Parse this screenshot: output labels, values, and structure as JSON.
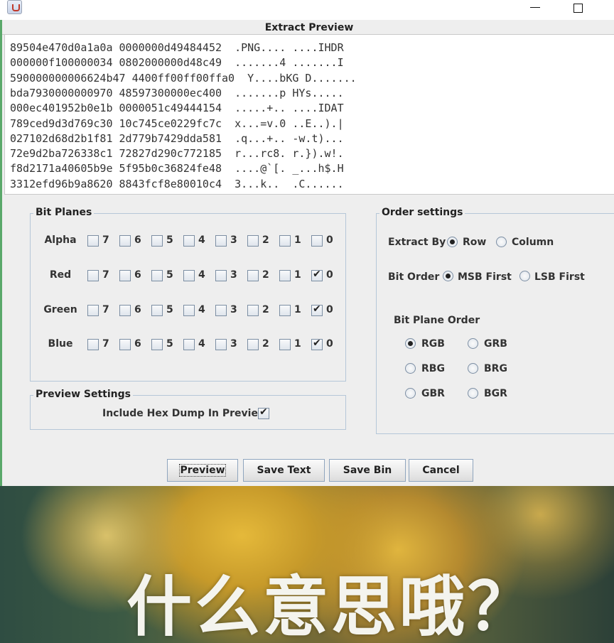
{
  "window": {
    "app_icon": "java-cup-icon"
  },
  "preview": {
    "title": "Extract Preview",
    "lines": [
      "89504e470d0a1a0a 0000000d49484452  .PNG.... ....IHDR",
      "000000f100000034 0802000000d48c49  .......4 .......I",
      "590000000006624b47 4400ff00ff00ffa0  Y....bKG D.......",
      "bda7930000000970 48597300000ec400  .......p HYs.....",
      "000ec401952b0e1b 0000051c49444154  .....+.. ....IDAT",
      "789ced9d3d769c30 10c745ce0229fc7c  x...=v.0 ..E..).|",
      "027102d68d2b1f81 2d779b7429dda581  .q...+.. -w.t)...",
      "72e9d2ba726338c1 72827d290c772185  r...rc8. r.}).w!.",
      "f8d2171a40605b9e 5f95b0c36824fe48  ....@`[. _...h$.H",
      "3312efd96b9a8620 8843fcf8e80010c4  3...k..  .C......"
    ]
  },
  "bit_planes": {
    "title": "Bit Planes",
    "bit_labels": [
      "7",
      "6",
      "5",
      "4",
      "3",
      "2",
      "1",
      "0"
    ],
    "rows": [
      {
        "label": "Alpha",
        "checked": [
          false,
          false,
          false,
          false,
          false,
          false,
          false,
          false
        ]
      },
      {
        "label": "Red",
        "checked": [
          false,
          false,
          false,
          false,
          false,
          false,
          false,
          true
        ]
      },
      {
        "label": "Green",
        "checked": [
          false,
          false,
          false,
          false,
          false,
          false,
          false,
          true
        ]
      },
      {
        "label": "Blue",
        "checked": [
          false,
          false,
          false,
          false,
          false,
          false,
          false,
          true
        ]
      }
    ]
  },
  "preview_settings": {
    "title": "Preview Settings",
    "hex_dump_label": "Include Hex Dump In Preview",
    "hex_dump_checked": true
  },
  "order_settings": {
    "title": "Order settings",
    "extract_by_label": "Extract By",
    "extract_by_options": [
      "Row",
      "Column"
    ],
    "extract_by_selected": "Row",
    "bit_order_label": "Bit Order",
    "bit_order_options": [
      "MSB First",
      "LSB First"
    ],
    "bit_order_selected": "MSB First",
    "plane_order_label": "Bit Plane Order",
    "plane_order_options": [
      "RGB",
      "GRB",
      "RBG",
      "BRG",
      "GBR",
      "BGR"
    ],
    "plane_order_selected": "RGB"
  },
  "buttons": {
    "preview": "Preview",
    "save_text": "Save Text",
    "save_bin": "Save Bin",
    "cancel": "Cancel"
  },
  "background": {
    "caption": "什么意思哦？"
  }
}
